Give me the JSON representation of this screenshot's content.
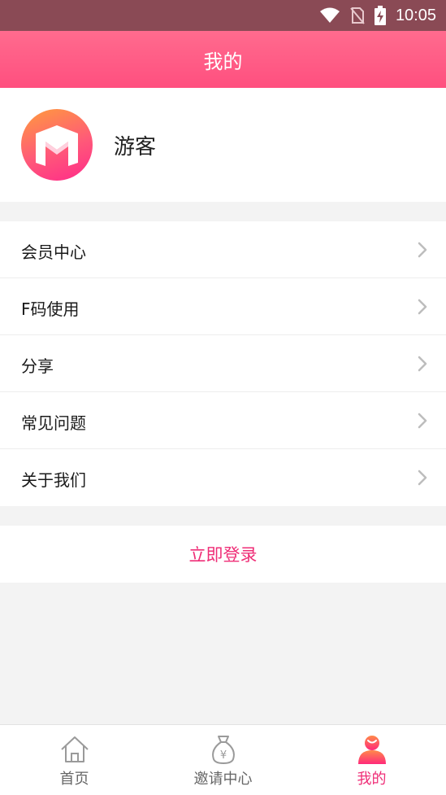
{
  "status_bar": {
    "time": "10:05"
  },
  "header": {
    "title": "我的"
  },
  "profile": {
    "username": "游客"
  },
  "menu": {
    "items": [
      {
        "label": "会员中心"
      },
      {
        "label": "F码使用"
      },
      {
        "label": "分享"
      },
      {
        "label": "常见问题"
      },
      {
        "label": "关于我们"
      }
    ]
  },
  "login": {
    "label": "立即登录"
  },
  "tabbar": {
    "tabs": [
      {
        "label": "首页",
        "icon": "home-icon"
      },
      {
        "label": "邀请中心",
        "icon": "money-bag-icon"
      },
      {
        "label": "我的",
        "icon": "user-icon",
        "active": true
      }
    ]
  },
  "colors": {
    "accent": "#ef2e77",
    "header_gradient_top": "#ff6b8e",
    "header_gradient_bottom": "#ff4f7f",
    "status_bar": "#8a4a55"
  }
}
